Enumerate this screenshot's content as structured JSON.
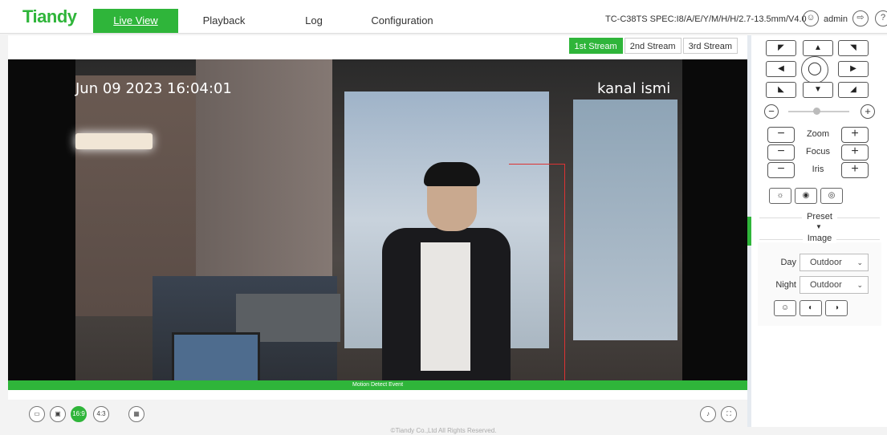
{
  "brand": "Tiandy",
  "nav": [
    "Live View",
    "Playback",
    "Log",
    "Configuration"
  ],
  "model": "TC-C38TS SPEC:I8/A/E/Y/M/H/H/2.7-13.5mm/V4.0",
  "user": "admin",
  "streams": [
    "1st Stream",
    "2nd Stream",
    "3rd Stream"
  ],
  "video": {
    "osd_time": "Jun 09 2023 16:04:01",
    "osd_name": "kanal ismi",
    "event": "Motion Detect Event"
  },
  "bottom_tools": [
    "",
    "",
    "16:9",
    "4:3",
    ""
  ],
  "footer": "©Tiandy Co.,Ltd All Rights Reserved.",
  "ptz": {
    "labels": [
      "Zoom",
      "Focus",
      "Iris"
    ],
    "preset_title": "Preset",
    "image_title": "Image",
    "day_label": "Day",
    "day_value": "Outdoor",
    "night_label": "Night",
    "night_value": "Outdoor"
  },
  "colors": {
    "accent": "#2fb53a"
  }
}
